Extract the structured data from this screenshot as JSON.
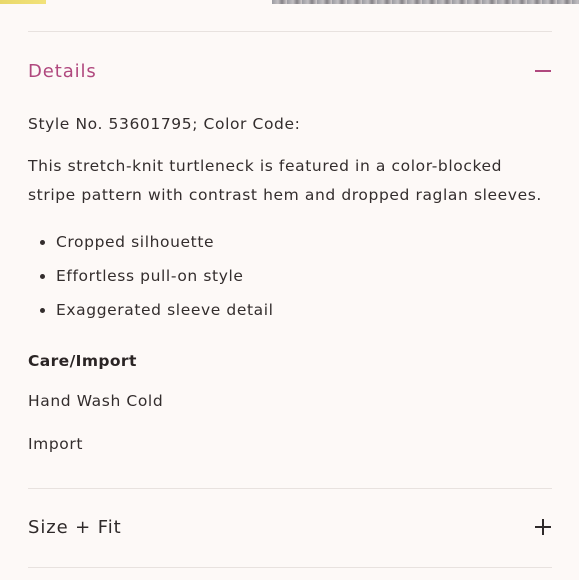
{
  "details": {
    "title": "Details",
    "toggle_icon": "minus-icon",
    "style_line": "Style No. 53601795; Color Code:",
    "description": "This stretch-knit turtleneck is featured in a color-blocked stripe pattern with contrast hem and dropped raglan sleeves.",
    "bullets": [
      "Cropped silhouette",
      "Effortless pull-on style",
      "Exaggerated sleeve detail"
    ],
    "care_heading": "Care/Import",
    "care_lines": [
      "Hand Wash Cold",
      "Import"
    ]
  },
  "size_fit": {
    "title": "Size + Fit",
    "toggle_icon": "plus-icon"
  },
  "colors": {
    "accent": "#b0487e",
    "text": "#2f2a2a",
    "background": "#fdf9f7",
    "divider": "#e8e2df"
  }
}
